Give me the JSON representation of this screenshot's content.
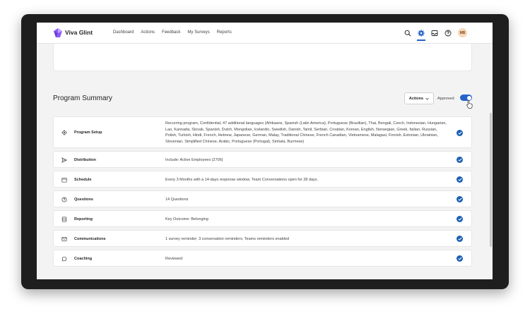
{
  "app": {
    "brand": "Viva Glint",
    "user_initials": "MB"
  },
  "nav": [
    "Dashboard",
    "Actions",
    "Feedback",
    "My Surveys",
    "Reports"
  ],
  "top_icons": [
    "search-icon",
    "gear-icon",
    "inbox-icon",
    "help-icon"
  ],
  "section": {
    "title": "Program Summary",
    "actions_label": "Actions",
    "approved_label": "Approved",
    "approved": true
  },
  "rows": [
    {
      "icon": "gear-icon",
      "label": "Program Setup",
      "value": "Recurring program, Confidential, 47 additional languages (Afrikaans, Spanish (Latin America), Portuguese (Brazilian), Thai, Bengali, Czech, Indonesian, Hungarian, Lao, Kannada, Slovak, Spanish, Dutch, Mongolian, Icelandic, Swedish, Danish, Tamil, Serbian, Croatian, Korean, English, Norwegian, Greek, Italian, Russian, Polish, Turkish, Hindi, French, Hebrew, Japanese, German, Malay, Traditional Chinese, French Canadian, Vietnamese, Malagasi, Finnish, Estonian, Ukrainian, Slovenian, Simplified Chinese, Arabic, Portuguese (Portugal), Sinhala, Burmese)"
    },
    {
      "icon": "send-icon",
      "label": "Distribution",
      "value": "Include: Active Employees (2706)"
    },
    {
      "icon": "calendar-icon",
      "label": "Schedule",
      "value": "Every 3 Months with a 14-days response window. Team Conversations open for 28 days."
    },
    {
      "icon": "question-icon",
      "label": "Questions",
      "value": "14 Questions"
    },
    {
      "icon": "database-icon",
      "label": "Reporting",
      "value": "Key Outcome: Belonging"
    },
    {
      "icon": "mail-icon",
      "label": "Communications",
      "value": "1 survey reminder; 3 conversation reminders; Teams reminders enabled"
    },
    {
      "icon": "chat-icon",
      "label": "Coaching",
      "value": "Reviewed"
    }
  ],
  "colors": {
    "accent": "#2563c9",
    "check": "#1a5fb4",
    "background": "#f3f3f3"
  }
}
